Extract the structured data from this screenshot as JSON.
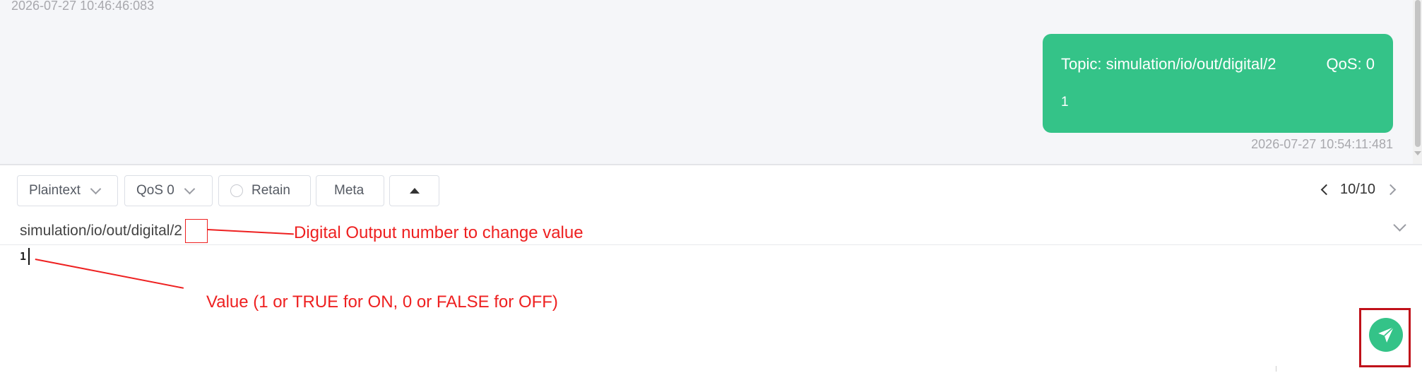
{
  "messages": {
    "top_timestamp": "2026-07-27 10:46:46:083",
    "outgoing": {
      "topic_label": "Topic: simulation/io/out/digital/2",
      "qos_label": "QoS: 0",
      "payload": "1",
      "timestamp": "2026-07-27 10:54:11:481",
      "bubble_color": "#34c388"
    }
  },
  "toolbar": {
    "format_select": "Plaintext",
    "qos_select": "QoS 0",
    "retain_label": "Retain",
    "meta_label": "Meta",
    "collapse_icon": "triangle-up-icon"
  },
  "pager": {
    "label": "10/10",
    "prev_icon": "chevron-left-icon",
    "next_icon": "chevron-right-icon"
  },
  "publish": {
    "topic_prefix": "simulation/io/out/digital/",
    "topic_suffix": "2",
    "payload": "1",
    "send_icon": "send-icon",
    "send_color": "#34c388"
  },
  "annotations": {
    "digital_output": "Digital Output number to change value",
    "value_hint": "Value (1 or TRUE for ON, 0 or FALSE for OFF)",
    "color": "#ee2020"
  }
}
